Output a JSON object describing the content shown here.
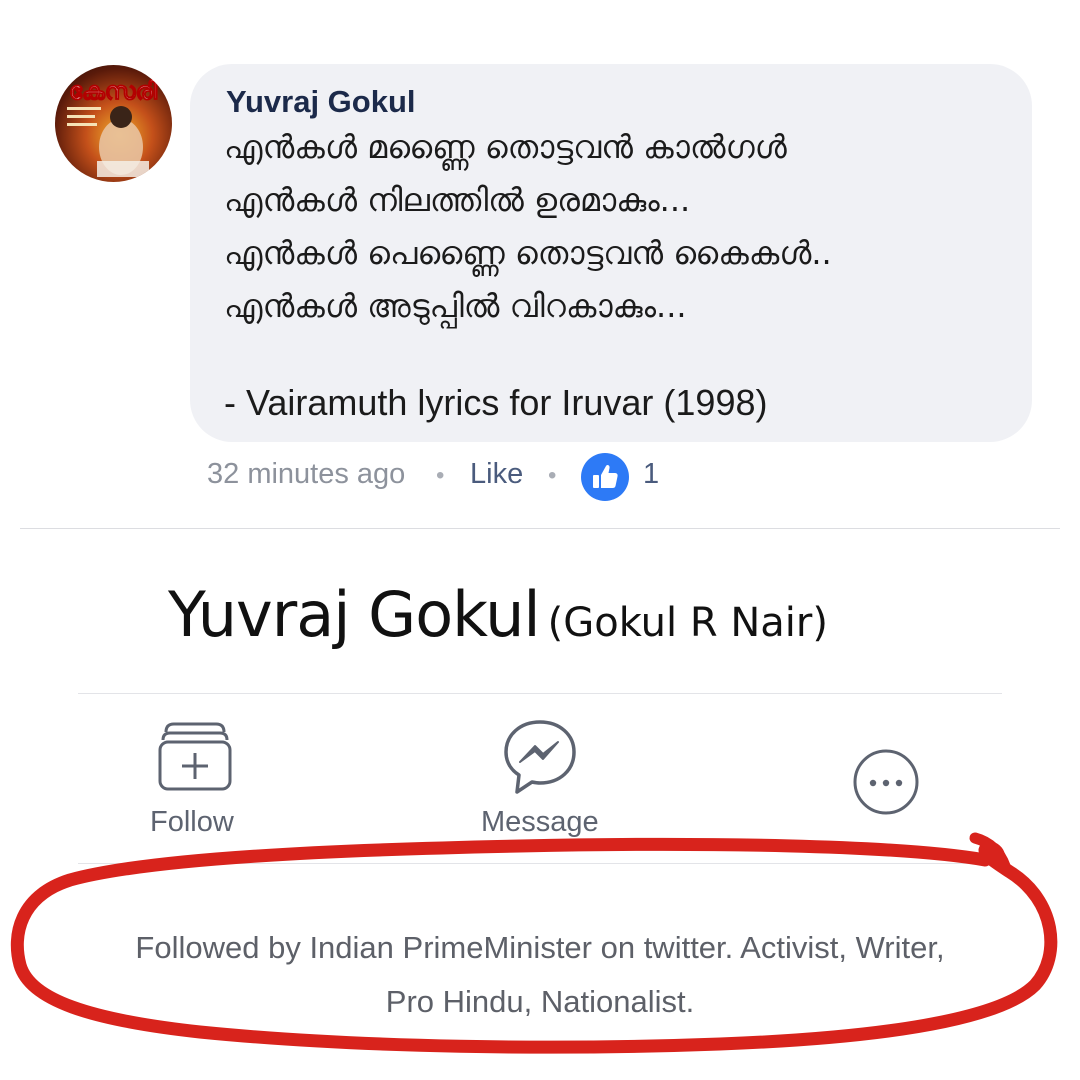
{
  "comment": {
    "author": "Yuvraj Gokul",
    "lines": [
      "എൻകൾ മണ്ണൈ തൊട്ടവൻ കാൽഗൾ",
      "എൻകൾ നിലത്തിൽ ഉരമാകും...",
      "എൻകൾ പെണ്ണൈ തൊട്ടവൻ കൈകൾ..",
      "എൻകൾ അടുപ്പിൽ വിറകാകും..."
    ],
    "attribution": "- Vairamuth lyrics for Iruvar (1998)",
    "timestamp": "32 minutes ago",
    "separator": "•",
    "like_label": "Like",
    "like_count": "1",
    "avatar_icon": "profile-photo-icon",
    "like_icon": "thumbs-up-icon"
  },
  "profile": {
    "name": "Yuvraj Gokul",
    "alternate_name": "(Gokul R Nair)",
    "actions": [
      {
        "label": "Follow",
        "icon": "follow-icon"
      },
      {
        "label": "Message",
        "icon": "messenger-icon"
      },
      {
        "label": "",
        "icon": "more-options-icon"
      }
    ],
    "bio_lines": [
      "Followed by Indian PrimeMinister on twitter. Activist, Writer,",
      "Pro Hindu, Nationalist."
    ]
  },
  "colors": {
    "bubble": "#f0f1f5",
    "like_blue": "#2d7af6",
    "annotation_red": "#d8231c",
    "icon_gray": "#5d6370"
  }
}
